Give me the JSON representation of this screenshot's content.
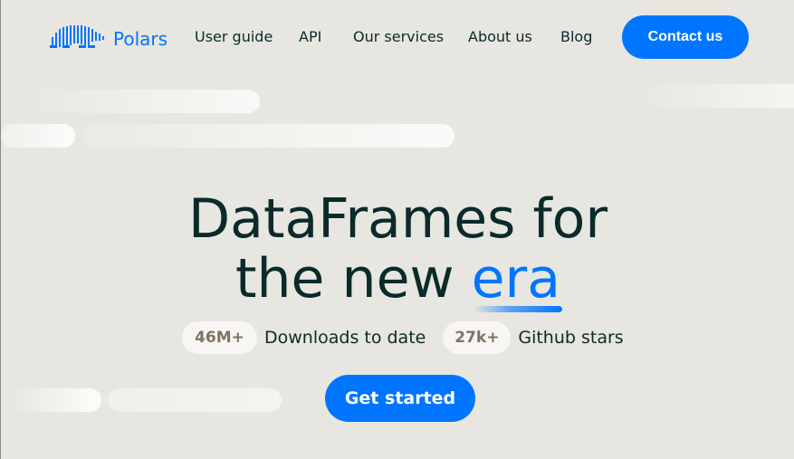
{
  "nav": {
    "logo_text": "Polars",
    "logo_icon": "polar-bear-icon",
    "links": [
      "User guide",
      "API",
      "Our services",
      "About us",
      "Blog"
    ],
    "cta": "Contact us"
  },
  "hero": {
    "line1": "DataFrames for",
    "line2_prefix": "the new",
    "line2_highlight": "era"
  },
  "stats": [
    {
      "value": "46M+",
      "label": "Downloads to date"
    },
    {
      "value": "27k+",
      "label": "Github stars"
    }
  ],
  "cta_primary": "Get started",
  "colors": {
    "accent": "#0075FF",
    "background": "#E7E6E0",
    "text": "#0B2A2A",
    "pill_text": "#7E7463"
  }
}
